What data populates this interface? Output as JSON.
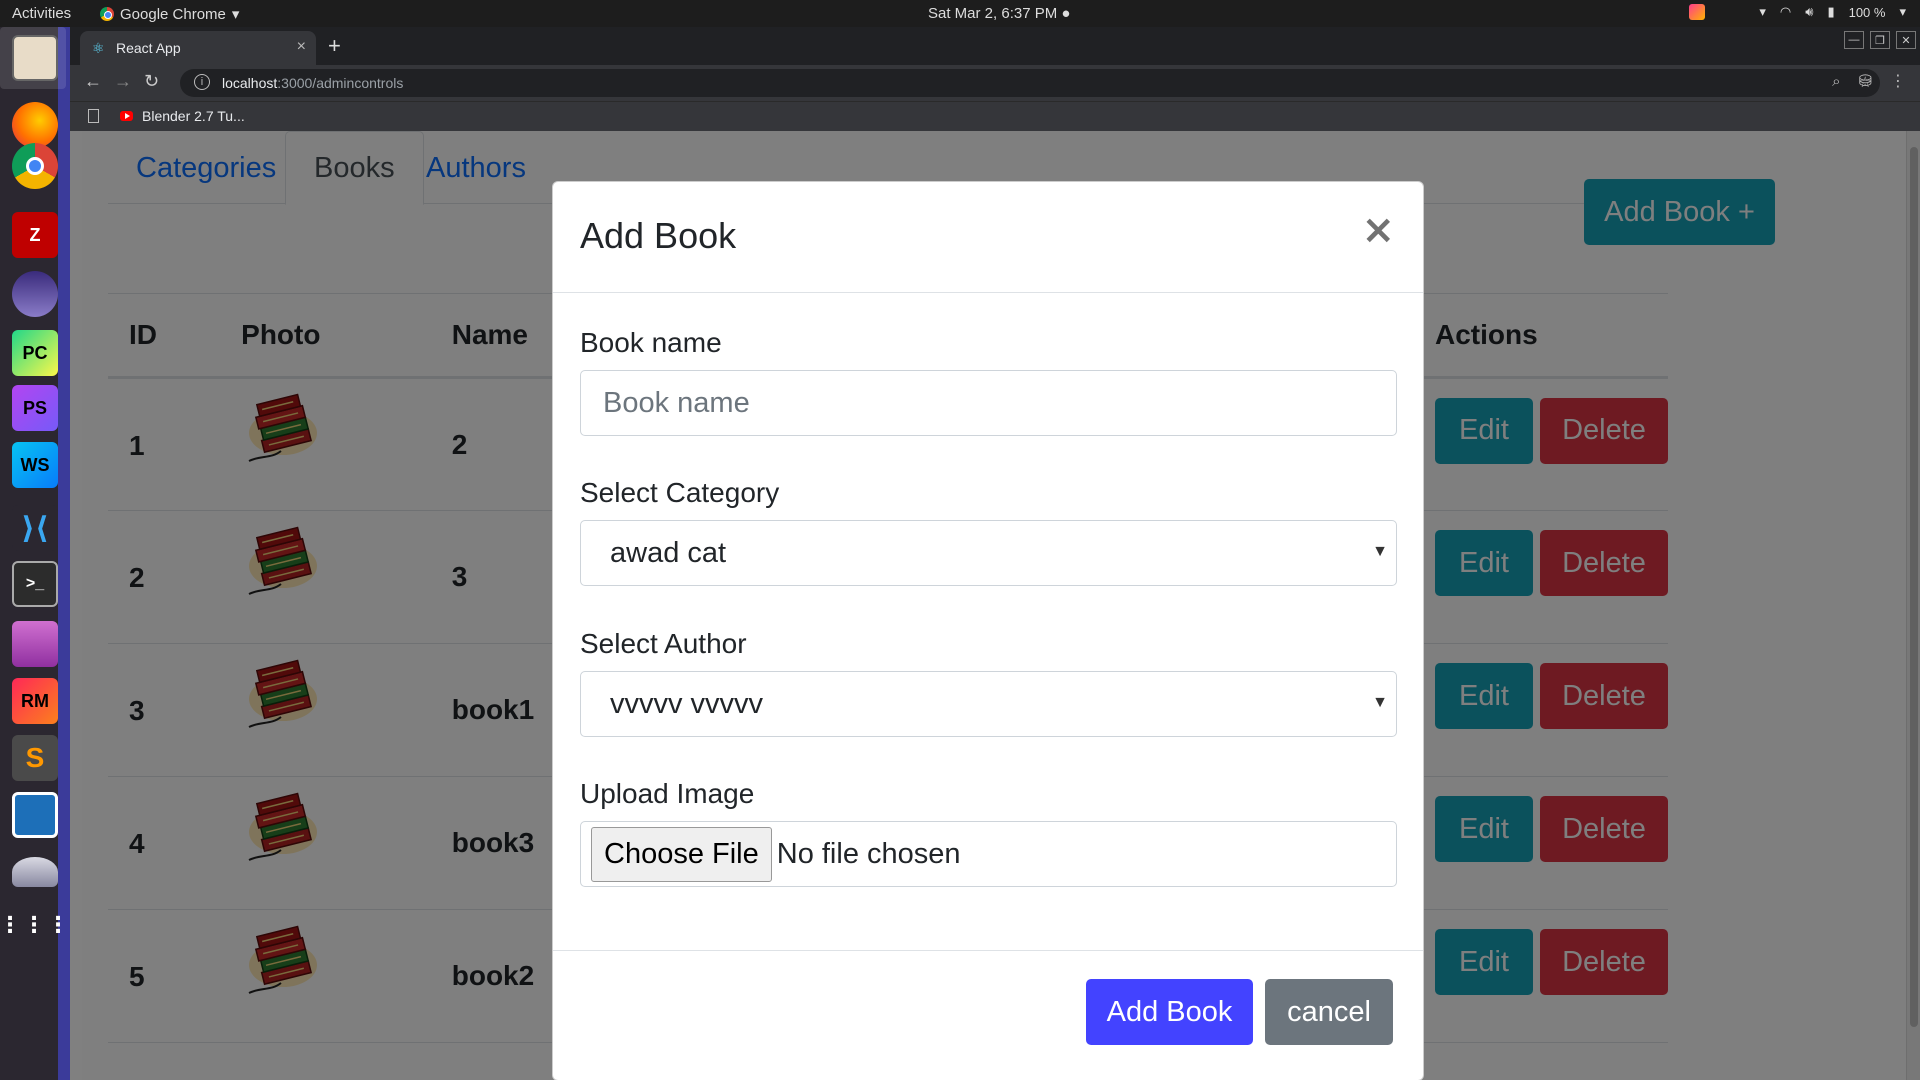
{
  "os": {
    "activities": "Activities",
    "app_name": "Google Chrome",
    "clock": "Sat Mar  2,  6:37 PM",
    "battery": "100 %"
  },
  "browser": {
    "tab_title": "React App",
    "url_host": "localhost",
    "url_path": ":3000/admincontrols",
    "bookmark_label": "Blender 2.7 Tu..."
  },
  "page": {
    "tabs": [
      "Categories",
      "Books",
      "Authors"
    ],
    "active_tab": "Books",
    "add_book_top_label": "Add Book +",
    "columns": {
      "id": "ID",
      "photo": "Photo",
      "name": "Name",
      "actions": "Actions"
    },
    "rows": [
      {
        "id": "1",
        "name": "2"
      },
      {
        "id": "2",
        "name": "3"
      },
      {
        "id": "3",
        "name": "book1"
      },
      {
        "id": "4",
        "name": "book3"
      },
      {
        "id": "5",
        "name": "book2"
      }
    ],
    "edit_label": "Edit",
    "delete_label": "Delete"
  },
  "modal": {
    "title": "Add Book",
    "close_symbol": "×",
    "book_name_label": "Book name",
    "book_name_placeholder": "Book name",
    "category_label": "Select Category",
    "category_value": "awad cat",
    "author_label": "Select Author",
    "author_value": "vvvvv vvvvv",
    "upload_label": "Upload Image",
    "choose_file": "Choose File",
    "no_file": "No file chosen",
    "submit_label": "Add Book",
    "cancel_label": "cancel"
  },
  "colors": {
    "teal": "#17a2b8",
    "danger": "#dc3545",
    "primary": "#4343ff",
    "secondary": "#6c757d",
    "link": "#0d6efd"
  }
}
